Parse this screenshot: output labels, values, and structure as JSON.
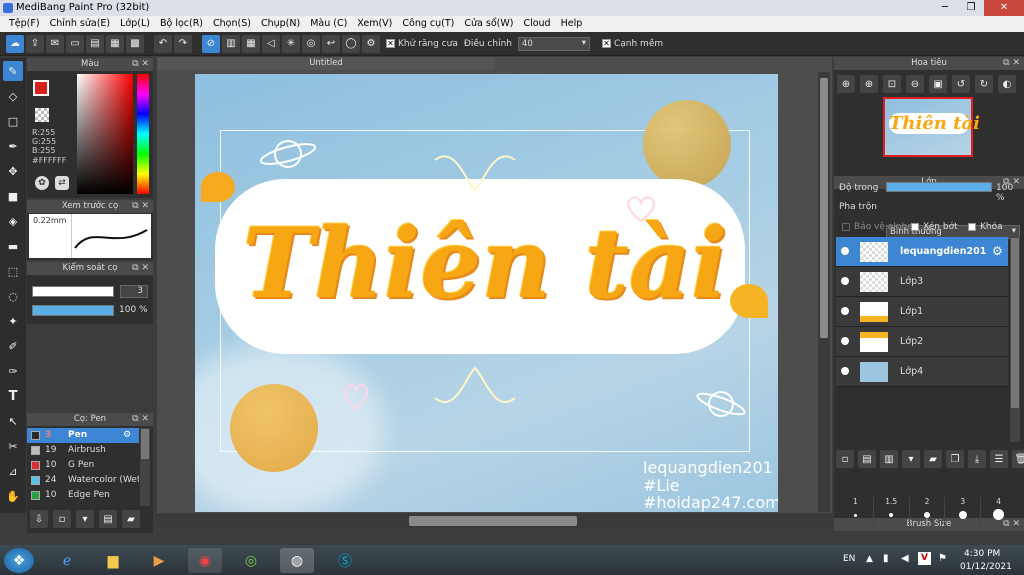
{
  "window": {
    "title": "MediBang Paint Pro (32bit)"
  },
  "menu": [
    "Tệp(F)",
    "Chỉnh sửa(E)",
    "Lớp(L)",
    "Bộ lọc(R)",
    "Chọn(S)",
    "Chụp(N)",
    "Màu (C)",
    "Xem(V)",
    "Công cụ(T)",
    "Cửa sổ(W)",
    "Cloud",
    "Help"
  ],
  "toolbar": {
    "antialias_label": "Khử răng cưa",
    "adjust_label": "Điều chỉnh",
    "adjust_value": "40",
    "edge_label": "Cạnh mềm"
  },
  "color_panel": {
    "title": "Màu",
    "r": "R:255",
    "g": "G:255",
    "b": "B:255",
    "hex": "#FFFFFF",
    "primary": "#d6201a"
  },
  "brush_preview": {
    "title": "Xem trước cọ",
    "size": "0.22mm"
  },
  "brush_control": {
    "title": "Kiểm soát cọ",
    "size_value": "3",
    "opacity_value": "100 %"
  },
  "brush_list": {
    "title": "Cọ: Pen",
    "items": [
      {
        "size": "3",
        "name": "Pen",
        "color": "#2b2b2b"
      },
      {
        "size": "19",
        "name": "Airbrush",
        "color": "#bdbdbd"
      },
      {
        "size": "10",
        "name": "G Pen",
        "color": "#d63030"
      },
      {
        "size": "24",
        "name": "Watercolor (Wet",
        "color": "#5bc0e8"
      },
      {
        "size": "10",
        "name": "Edge Pen",
        "color": "#2ea043"
      }
    ]
  },
  "canvas": {
    "doc_title": "Untitled",
    "art_text": "Thiên tài",
    "credits": [
      "lequangdien201",
      "#Lie",
      "#hoidap247.com"
    ]
  },
  "navigator": {
    "title": "Hoa tiêu",
    "thumb_text": "Thiên tài"
  },
  "layers": {
    "title": "Lớp",
    "opacity_label": "Độ trong",
    "opacity_value": "100 %",
    "blend_label": "Pha trộn",
    "blend_value": "Bình thường",
    "protect_alpha": "Bảo vệ alpha",
    "clipping": "Xén bớt",
    "lock": "Khóa",
    "items": [
      {
        "name": "lequangdien201",
        "selected": true
      },
      {
        "name": "Lớp3",
        "selected": false
      },
      {
        "name": "Lớp1",
        "selected": false
      },
      {
        "name": "Lớp2",
        "selected": false
      },
      {
        "name": "Lớp4",
        "selected": false
      }
    ]
  },
  "brush_size": {
    "title": "Brush Size",
    "sizes": [
      "1",
      "1.5",
      "2",
      "3",
      "4"
    ]
  },
  "taskbar": {
    "lang": "EN",
    "time": "4:30 PM",
    "date": "01/12/2021"
  }
}
